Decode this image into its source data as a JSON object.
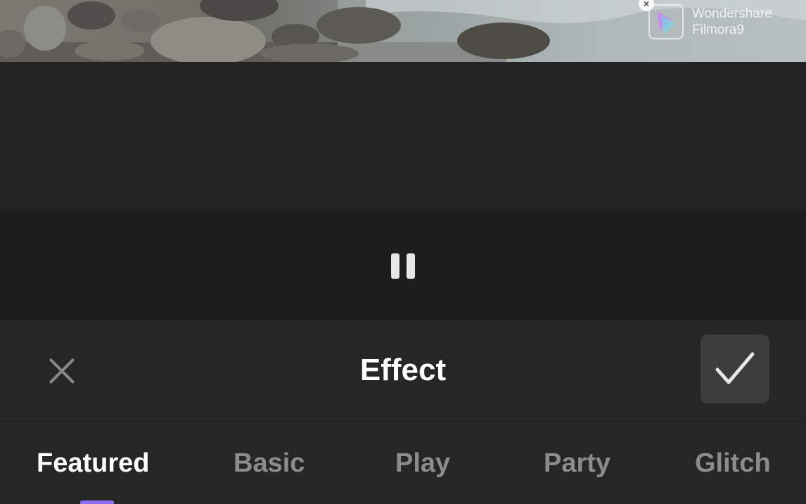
{
  "watermark": {
    "line1": "Wondershare",
    "line2": "Filmora9"
  },
  "effect_panel": {
    "title": "Effect",
    "tabs": [
      {
        "label": "Featured",
        "active": true
      },
      {
        "label": "Basic",
        "active": false
      },
      {
        "label": "Play",
        "active": false
      },
      {
        "label": "Party",
        "active": false
      },
      {
        "label": "Glitch",
        "active": false
      }
    ]
  },
  "icons": {
    "close": "close-icon",
    "confirm": "checkmark-icon",
    "pause": "pause-icon",
    "watermark_close": "close-icon"
  },
  "colors": {
    "accent": "#8b6cf5",
    "panel_bg": "#262626",
    "active_tab": "#ffffff",
    "inactive_tab": "#8c8c8c"
  }
}
